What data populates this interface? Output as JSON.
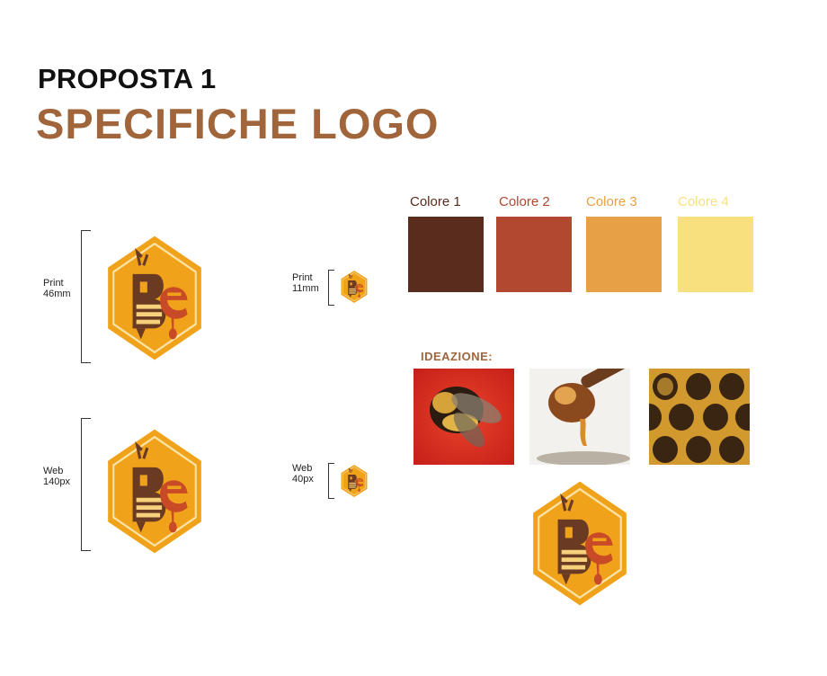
{
  "header": {
    "subtitle": "PROPOSTA 1",
    "title": "SPECIFICHE LOGO"
  },
  "sizes": {
    "print_large": {
      "line1": "Print",
      "line2": "46mm"
    },
    "web_large": {
      "line1": "Web",
      "line2": "140px"
    },
    "print_small": {
      "line1": "Print",
      "line2": "11mm"
    },
    "web_small": {
      "line1": "Web",
      "line2": "40px"
    }
  },
  "colors": [
    {
      "label": "Colore 1",
      "hex": "#5a2c1d"
    },
    {
      "label": "Colore 2",
      "hex": "#b2482f"
    },
    {
      "label": "Colore 3",
      "hex": "#e7a046"
    },
    {
      "label": "Colore 4",
      "hex": "#f8e07e"
    }
  ],
  "ideation": {
    "heading": "IDEAZIONE:",
    "images": [
      "bee-photo",
      "honey-dipper-photo",
      "honeycomb-photo"
    ]
  },
  "logo": {
    "hex_outer": "#f0a21b",
    "ring": "#fbe3a6",
    "letter_b": "#6a3a22",
    "letter_e": "#c84a26",
    "stripe": "#f6d07a"
  }
}
